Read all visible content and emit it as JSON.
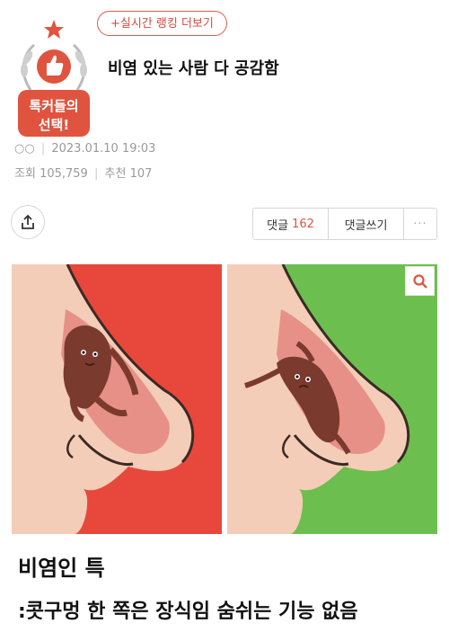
{
  "ranking_link": {
    "label": "+실시간 랭킹 더보기"
  },
  "badge": {
    "line1": "톡커들의",
    "line2": "선택!",
    "accent": "#e0533f"
  },
  "post": {
    "title": "비염 있는 사람 다 공감함",
    "author_icons": "○○",
    "date": "2023.01.10 19:03",
    "views_label": "조회",
    "views": "105,759",
    "recommend_label": "추천",
    "recommend": "107"
  },
  "actions": {
    "share_icon": "share-icon",
    "comments_label": "댓글",
    "comments_count": "162",
    "write_label": "댓글쓰기",
    "more_label": "···"
  },
  "image": {
    "left_bg": "#e8473b",
    "right_bg": "#6cbf4f",
    "zoom_icon": "search-icon"
  },
  "caption": {
    "title": "비염인 특",
    "text": ":콧구멍 한 쪽은 장식임 숨쉬는 기능 없음"
  }
}
